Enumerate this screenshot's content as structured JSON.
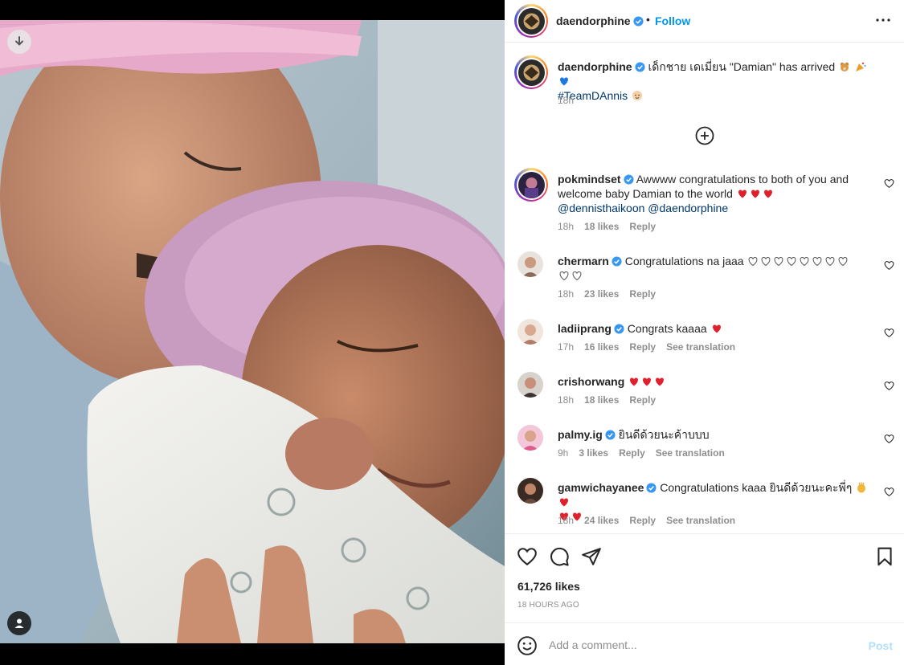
{
  "post": {
    "username": "daendorphine",
    "follow_label": "Follow",
    "separator": "•",
    "likes": "61,726 likes",
    "timestamp": "18 HOURS AGO"
  },
  "caption": {
    "username": "daendorphine",
    "text": "เด็กชาย เดเมี่ยน \"Damian\" has arrived",
    "hashtag": "#TeamDAnnis",
    "time": "18h"
  },
  "comments": [
    {
      "username": "pokmindset",
      "text": "Awwww congratulations to both of you and welcome baby Damian to the world",
      "mentions": "@dennisthaikoon @daendorphine",
      "time": "18h",
      "likes": "18 likes",
      "reply": "Reply",
      "translation": ""
    },
    {
      "username": "chermarn",
      "text": "Congratulations na jaaa",
      "time": "18h",
      "likes": "23 likes",
      "reply": "Reply",
      "translation": ""
    },
    {
      "username": "ladiiprang",
      "text": "Congrats kaaaa",
      "time": "17h",
      "likes": "16 likes",
      "reply": "Reply",
      "translation": "See translation"
    },
    {
      "username": "crishorwang",
      "text": "",
      "time": "18h",
      "likes": "18 likes",
      "reply": "Reply",
      "translation": ""
    },
    {
      "username": "palmy.ig",
      "text": "ยินดีด้วยนะค้าบบบ",
      "time": "9h",
      "likes": "3 likes",
      "reply": "Reply",
      "translation": "See translation"
    },
    {
      "username": "gamwichayanee",
      "text": "Congratulations kaaa ยินดีด้วยนะคะพี่ๆ",
      "time": "18h",
      "likes": "24 likes",
      "reply": "Reply",
      "translation": "See translation"
    }
  ],
  "comment_box": {
    "placeholder": "Add a comment...",
    "post_label": "Post"
  },
  "colors": {
    "accent": "#0095f6",
    "verified": "#3897f0",
    "heart_red": "#ed4956",
    "muted": "#8e8e8e",
    "post_disabled": "#b2dffc"
  },
  "icons": [
    "download-icon",
    "tag-people-icon",
    "verified-icon",
    "more-icon",
    "add-circle-icon",
    "heart-icon",
    "comment-icon",
    "share-icon",
    "bookmark-icon",
    "emoji-icon"
  ]
}
